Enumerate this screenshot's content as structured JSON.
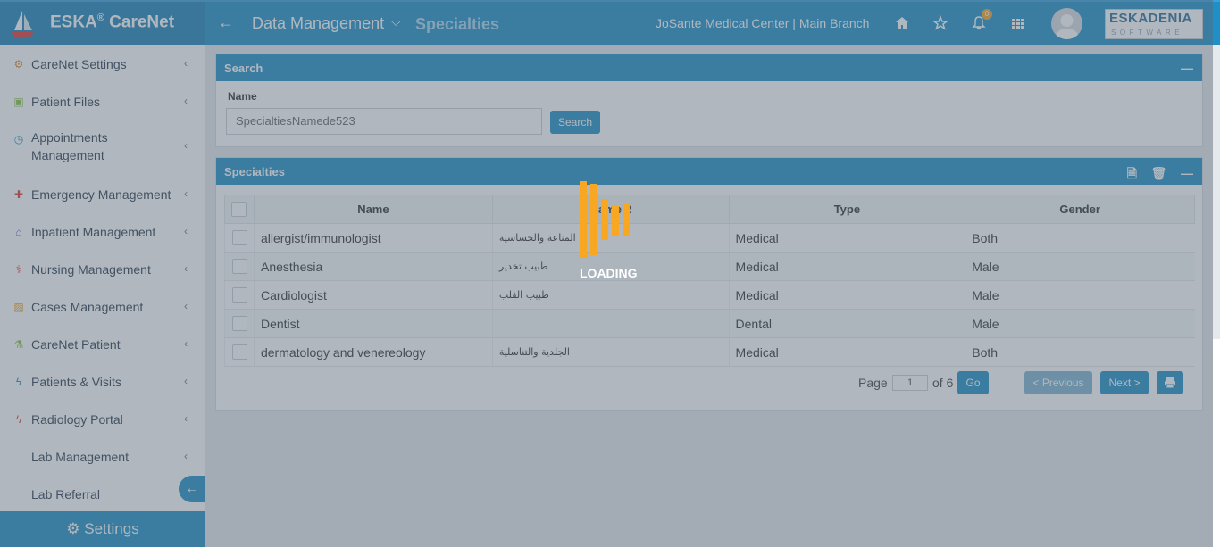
{
  "app": {
    "brand_name": "ESKA",
    "brand_reg": "®",
    "brand_suffix": " CareNet",
    "breadcrumb_main": "Data Management",
    "breadcrumb_current": "Specialties",
    "center_branch": "JoSante Medical Center | Main Branch",
    "notification_count": "0",
    "company_logo_line1": "ESKADENIA",
    "company_logo_line2": "SOFTWARE"
  },
  "sidebar": {
    "items": [
      {
        "label": "CareNet Settings",
        "icon": "gear-icon",
        "color": "#e67e22"
      },
      {
        "label": "Patient Files",
        "icon": "folder-icon",
        "color": "#8bc34a"
      },
      {
        "label": "Appointments Management",
        "icon": "clock-icon",
        "color": "#1f8fc7"
      },
      {
        "label": "Emergency Management",
        "icon": "plus-icon",
        "color": "#e53935"
      },
      {
        "label": "Inpatient Management",
        "icon": "home-icon",
        "color": "#5c6bc0"
      },
      {
        "label": "Nursing Management",
        "icon": "stethoscope-icon",
        "color": "#e53935"
      },
      {
        "label": "Cases Management",
        "icon": "image-icon",
        "color": "#f39c12"
      },
      {
        "label": "CareNet Patient",
        "icon": "flask-icon",
        "color": "#8bc34a"
      },
      {
        "label": "Patients & Visits",
        "icon": "bolt-icon",
        "color": "#1f8fc7"
      },
      {
        "label": "Radiology Portal",
        "icon": "bolt-icon",
        "color": "#e53935"
      },
      {
        "label": "Lab Management",
        "icon": "",
        "color": "#2c3e50"
      },
      {
        "label": "Lab Referral",
        "icon": "",
        "color": "#2c3e50"
      }
    ],
    "footer_label": "Settings"
  },
  "search_panel": {
    "title": "Search",
    "name_label": "Name",
    "name_value": "SpecialtiesNamede523",
    "search_button": "Search"
  },
  "specialties_panel": {
    "title": "Specialties",
    "columns": [
      "Name",
      "Name 2",
      "Type",
      "Gender"
    ],
    "rows": [
      {
        "name": "allergist/immunologist",
        "name2": "المناعة والحساسية",
        "type": "Medical",
        "gender": "Both"
      },
      {
        "name": "Anesthesia",
        "name2": "طبيب تخدير",
        "type": "Medical",
        "gender": "Male"
      },
      {
        "name": "Cardiologist",
        "name2": "طبيب القلب",
        "type": "Medical",
        "gender": "Male"
      },
      {
        "name": "Dentist",
        "name2": "",
        "type": "Dental",
        "gender": "Male"
      },
      {
        "name": "dermatology and venereology",
        "name2": "الجلدية والتناسلية",
        "type": "Medical",
        "gender": "Both"
      }
    ],
    "pager": {
      "page_label": "Page",
      "page_value": "1",
      "of_label": "of 6",
      "go_button": "Go",
      "previous_button": "< Previous",
      "next_button": "Next >"
    }
  },
  "loading": {
    "text": "LOADING",
    "color": "#f7a722"
  }
}
